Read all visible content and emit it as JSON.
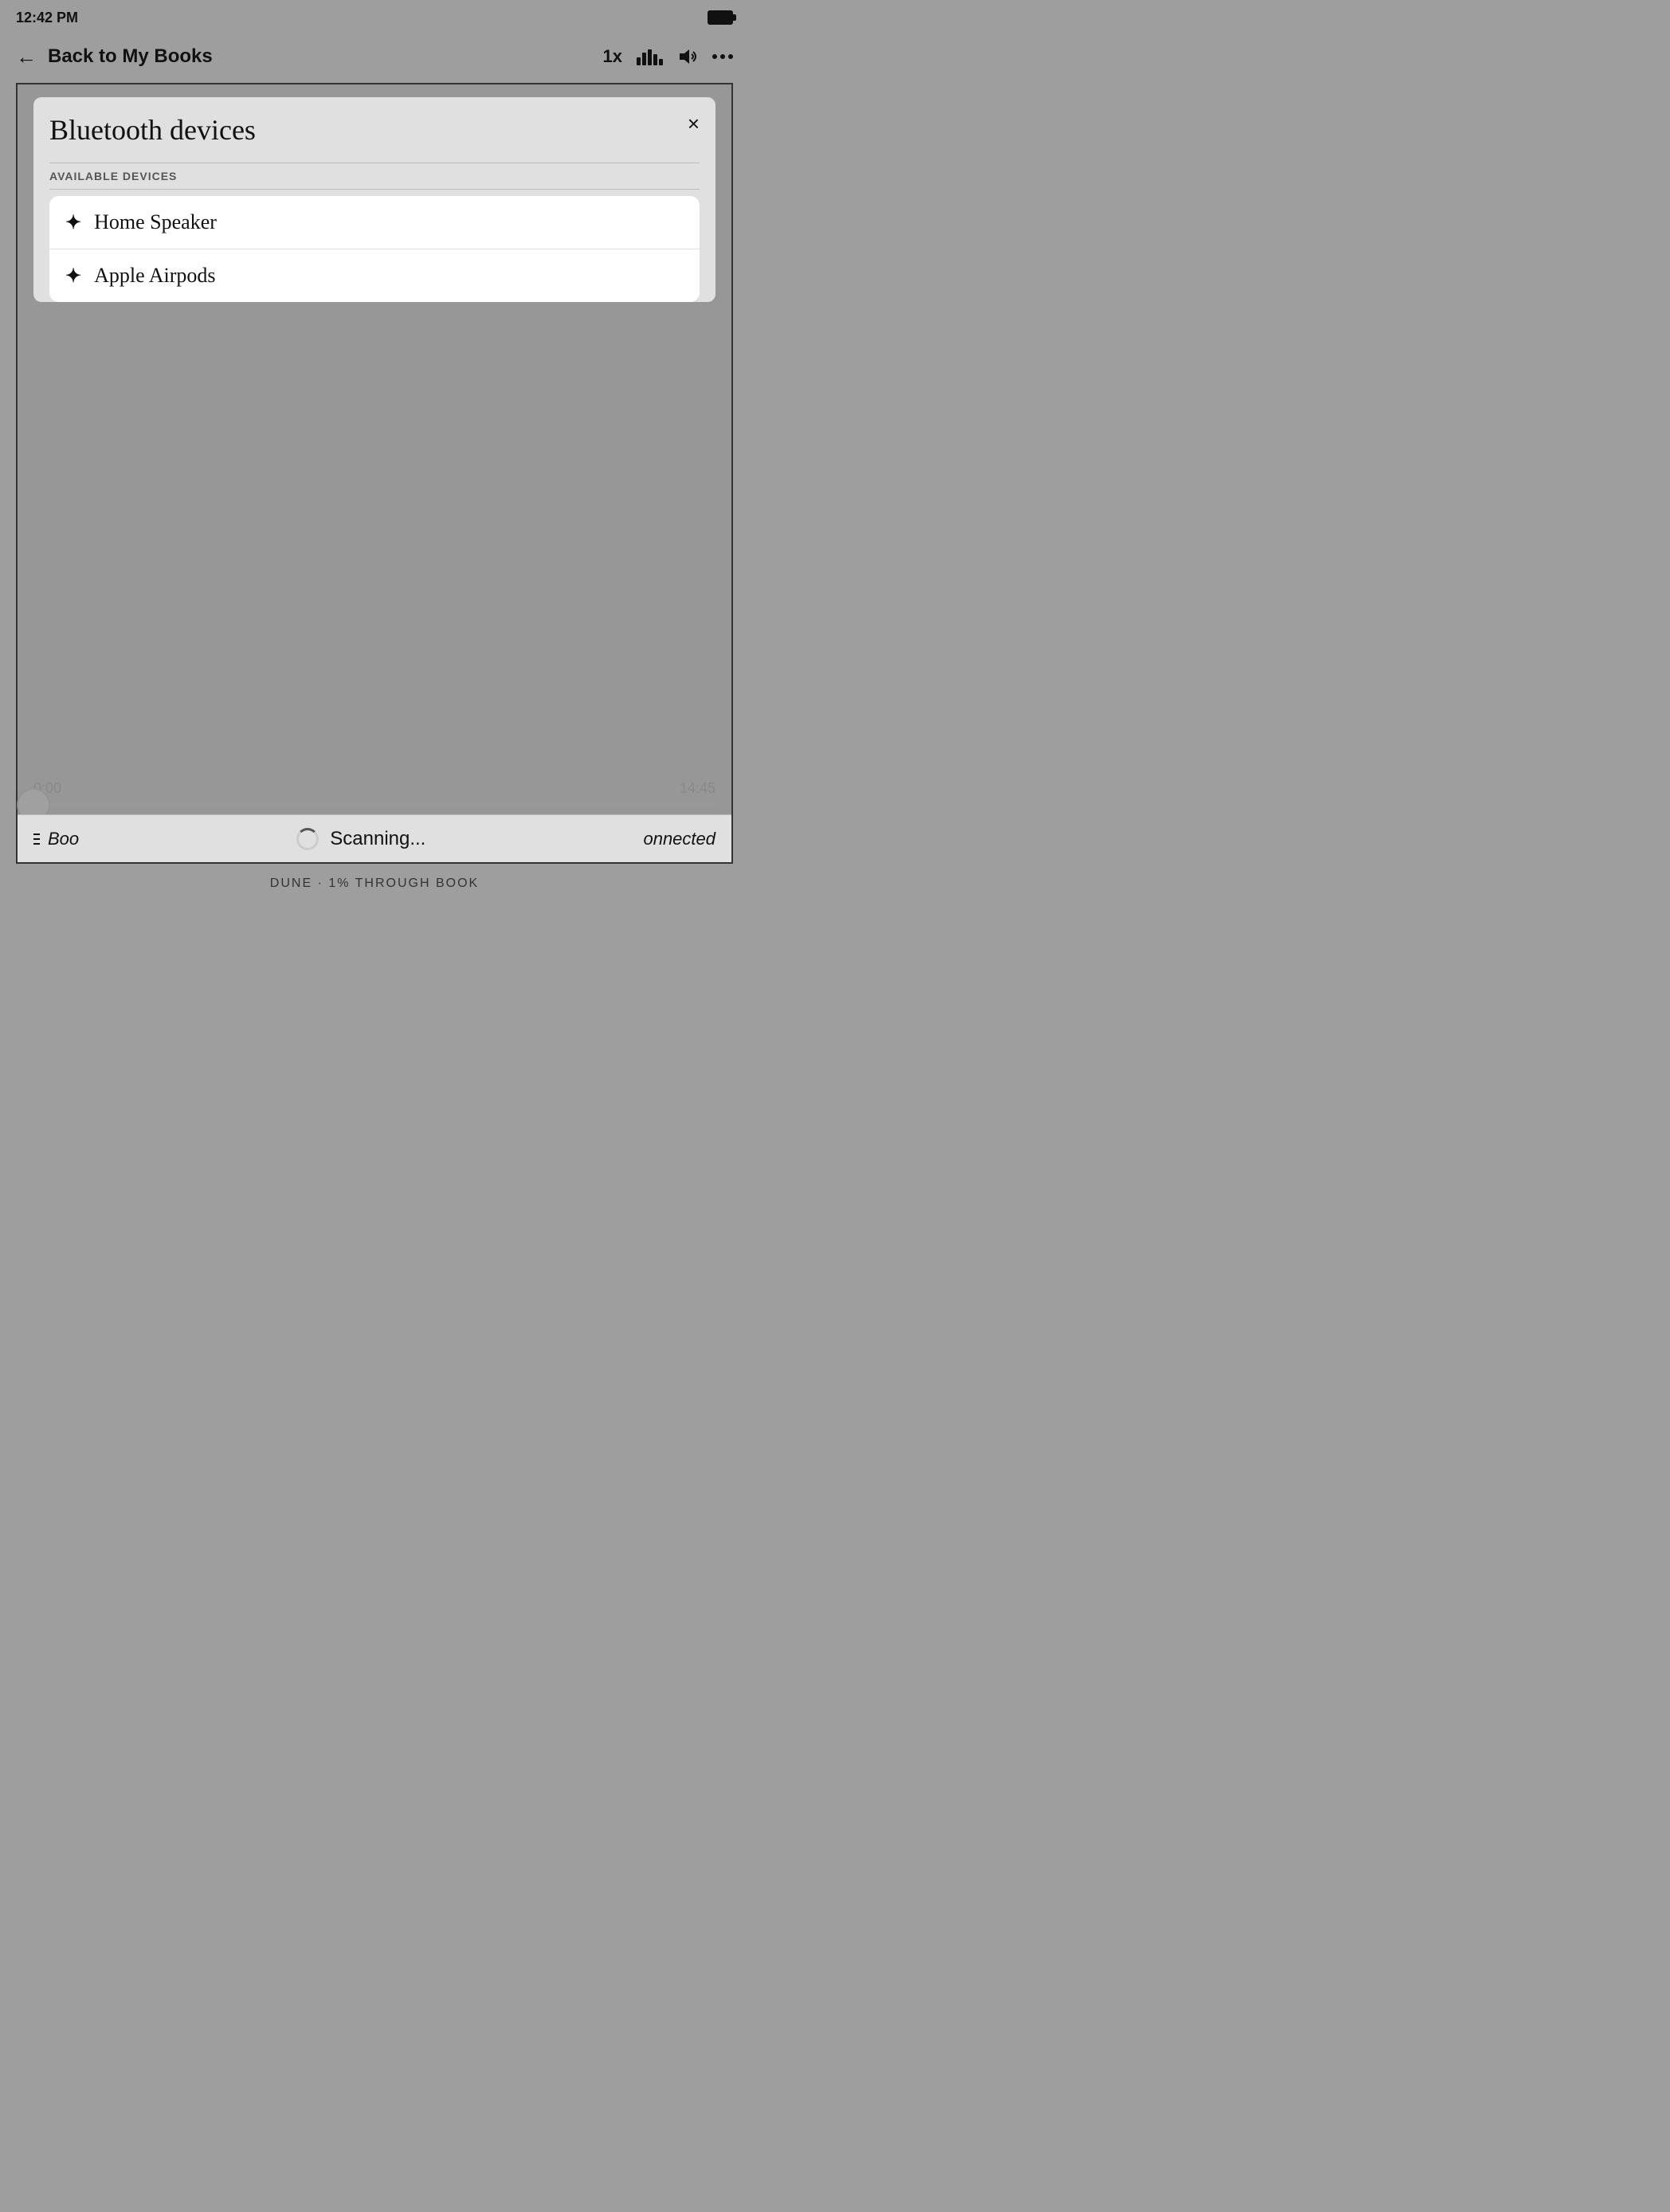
{
  "statusBar": {
    "time": "12:42 PM"
  },
  "nav": {
    "backLabel": "Back to My Books",
    "speed": "1x",
    "moreLabel": "..."
  },
  "barChart": {
    "bars": [
      12,
      18,
      22,
      16,
      10
    ]
  },
  "modal": {
    "title": "Bluetooth devices",
    "closeLabel": "×",
    "sectionLabel": "AVAILABLE DEVICES",
    "devices": [
      {
        "name": "Home Speaker"
      },
      {
        "name": "Apple Airpods"
      }
    ]
  },
  "progress": {
    "currentTime": "0:00",
    "totalTime": "14:45"
  },
  "bottomBar": {
    "bookLabel": "Boo",
    "scanningLabel": "Scanning...",
    "connectedLabel": "onnected"
  },
  "footer": {
    "text": "DUNE · 1% THROUGH BOOK"
  }
}
